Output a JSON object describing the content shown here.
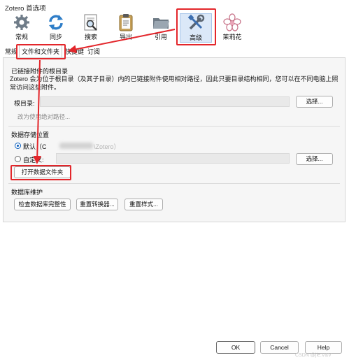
{
  "window": {
    "title": "Zotero 首选项"
  },
  "toolbar": {
    "items": [
      {
        "label": "常规",
        "icon": "gear-icon"
      },
      {
        "label": "同步",
        "icon": "sync-icon"
      },
      {
        "label": "搜索",
        "icon": "search-icon"
      },
      {
        "label": "导出",
        "icon": "clipboard-icon"
      },
      {
        "label": "引用",
        "icon": "folder-icon"
      },
      {
        "label": "高级",
        "icon": "tools-icon"
      },
      {
        "label": "茉莉花",
        "icon": "flower-icon"
      }
    ],
    "active": "高级"
  },
  "tabs": [
    {
      "label": "常规"
    },
    {
      "label": "文件和文件夹",
      "selected": true
    },
    {
      "label": "快捷键"
    },
    {
      "label": "订阅"
    }
  ],
  "linked": {
    "title": "已链接附件的根目录",
    "description": "Zotero 会为位于根目录（及其子目录）内的已链接附件使用相对路径，因此只要目录结构相同，您可以在不同电脑上照常访问这些附件。",
    "base_label": "根目录:",
    "base_value": "",
    "choose_label": "选择...",
    "revert_label": "改为使用绝对路径..."
  },
  "data_dir": {
    "title": "数据存储位置",
    "default_label": "默认（C",
    "default_suffix": "\\Zotero）",
    "custom_label": "自定义:",
    "choose_label": "选择...",
    "open_label": "打开数据文件夹"
  },
  "maintenance": {
    "title": "数据库维护",
    "check_label": "检查数据库完整性",
    "reset_translators_label": "重置转换器...",
    "reset_styles_label": "重置样式..."
  },
  "footer": {
    "ok_label": "OK",
    "cancel_label": "Cancel",
    "help_label": "Help"
  },
  "watermark": "CSDN @jie.V&V",
  "annotation_color": "#e3262b"
}
